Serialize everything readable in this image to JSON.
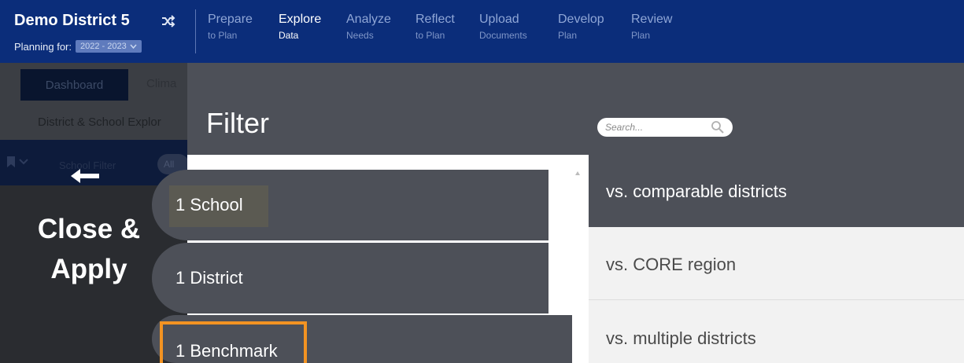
{
  "header": {
    "district_name": "Demo District 5",
    "switch_icon": "shuffle-icon",
    "planning_label": "Planning for:",
    "year_selected": "2022 - 2023"
  },
  "nav": [
    {
      "main": "Prepare",
      "sub": "to Plan"
    },
    {
      "main": "Explore",
      "sub": "Data",
      "active": true
    },
    {
      "main": "Analyze",
      "sub": "Needs"
    },
    {
      "main": "Reflect",
      "sub": "to Plan"
    },
    {
      "main": "Upload",
      "sub": "Documents"
    },
    {
      "main": "Develop",
      "sub": "Plan"
    },
    {
      "main": "Review",
      "sub": "Plan"
    }
  ],
  "background": {
    "dashboard_tab": "Dashboard",
    "climate_tab_partial": "Clima",
    "explorer_partial": "District & School Explor",
    "filter_partial": "School Filter",
    "pill_partial": "All"
  },
  "overlay": {
    "close_line1": "Close &",
    "close_line2": "Apply",
    "filter_title": "Filter",
    "search_placeholder": "Search..."
  },
  "filter_tabs": [
    "1 School",
    "1 District",
    "1 Benchmark"
  ],
  "options": [
    "vs. comparable districts",
    "vs. CORE region",
    "vs. multiple districts"
  ],
  "colors": {
    "nav_bg": "#0b2d7a",
    "panel_dark": "#4d5058",
    "highlight_orange": "#f39322"
  }
}
